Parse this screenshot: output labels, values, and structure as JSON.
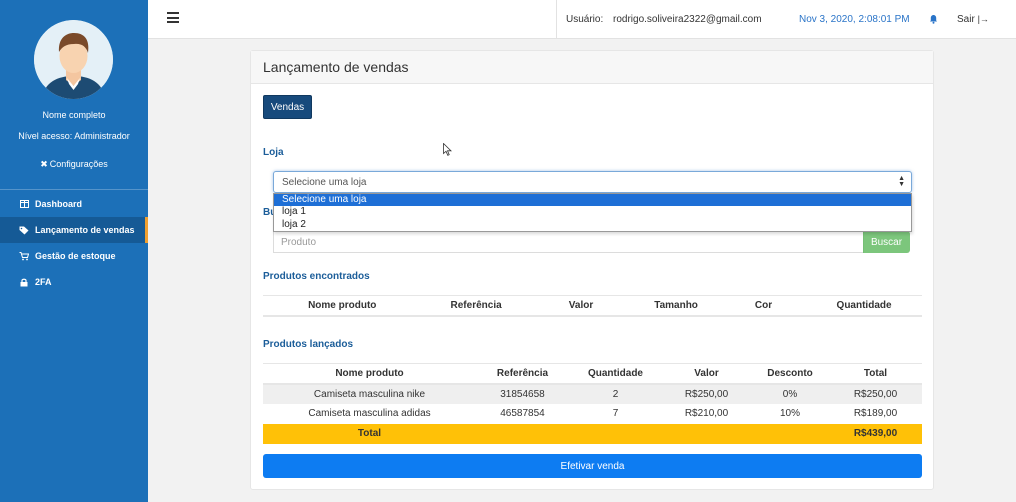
{
  "sidebar": {
    "name": "Nome completo",
    "access": "Nível acesso: Administrador",
    "config_label": "Configurações",
    "items": [
      {
        "label": "Dashboard",
        "icon": "dashboard-icon"
      },
      {
        "label": "Lançamento de vendas",
        "icon": "tag-icon",
        "active": true
      },
      {
        "label": "Gestão de estoque",
        "icon": "cart-icon"
      },
      {
        "label": "2FA",
        "icon": "lock-icon"
      }
    ]
  },
  "topbar": {
    "user_label": "Usuário:",
    "user_email": "rodrigo.soliveira2322@gmail.com",
    "datetime": "Nov 3, 2020, 2:08:01 PM",
    "logout_label": "Sair"
  },
  "card": {
    "title": "Lançamento de vendas",
    "vendas_button": "Vendas",
    "loja_label": "Loja",
    "select_value": "Selecione uma loja",
    "select_options": [
      "Selecione uma loja",
      "loja 1",
      "loja 2"
    ],
    "busca_label": "Bu",
    "product_placeholder": "Produto",
    "buscar_button": "Buscar",
    "found_label": "Produtos encontrados",
    "found_headers": [
      "Nome produto",
      "Referência",
      "Valor",
      "Tamanho",
      "Cor",
      "Quantidade"
    ],
    "launched_label": "Produtos lançados",
    "launched_headers": [
      "Nome produto",
      "Referência",
      "Quantidade",
      "Valor",
      "Desconto",
      "Total"
    ],
    "launched_rows": [
      [
        "Camiseta masculina nike",
        "31854658",
        "2",
        "R$250,00",
        "0%",
        "R$250,00"
      ],
      [
        "Camiseta masculina adidas",
        "46587854",
        "7",
        "R$210,00",
        "10%",
        "R$189,00"
      ]
    ],
    "total_label": "Total",
    "total_value": "R$439,00",
    "efetivar_button": "Efetivar venda"
  },
  "colors": {
    "sidebar": "#1c70b8",
    "primary": "#0d7cf2",
    "success": "#5cb85c",
    "warning": "#ffc107",
    "dark_button": "#174a7c"
  }
}
